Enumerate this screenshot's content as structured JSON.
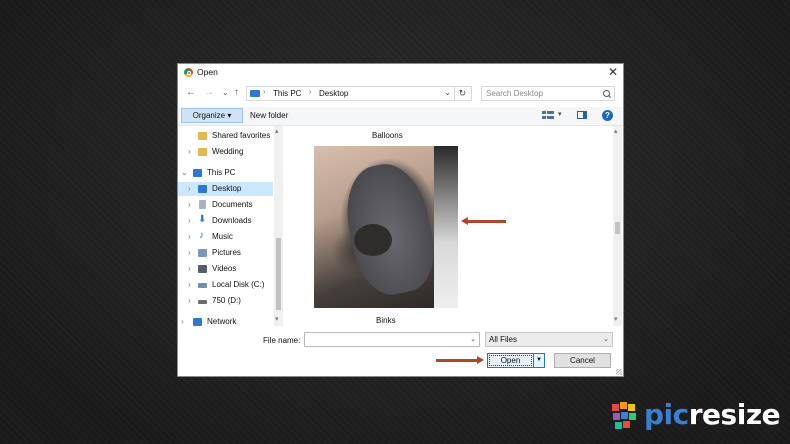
{
  "dialog": {
    "title": "Open",
    "app_icon": "chrome-icon",
    "close_glyph": "✕"
  },
  "navbar": {
    "back_glyph": "←",
    "forward_glyph": "→",
    "history_glyph": "⌄",
    "up_glyph": "↑",
    "breadcrumbs": [
      "This PC",
      "Desktop"
    ],
    "separator": "›",
    "refresh_glyph": "↻",
    "search_placeholder": "Search Desktop"
  },
  "toolbar": {
    "organize_label": "Organize ▾",
    "new_folder_label": "New folder",
    "help_glyph": "?"
  },
  "nav_pane": {
    "items": [
      {
        "label": "Shared favorites",
        "icon": "folder-image-icon",
        "color": "#e6b84a",
        "selected": false
      },
      {
        "label": "Wedding",
        "icon": "folder-image-icon",
        "color": "#e6b84a",
        "selected": false
      },
      {
        "label": "This PC",
        "icon": "computer-icon",
        "color": "#2b79d0",
        "selected": false
      },
      {
        "label": "Desktop",
        "icon": "desktop-icon",
        "color": "#2b79d0",
        "selected": true
      },
      {
        "label": "Documents",
        "icon": "documents-icon",
        "color": "#a9b3bf",
        "selected": false
      },
      {
        "label": "Downloads",
        "icon": "downloads-icon",
        "color": "#2b79d0",
        "selected": false
      },
      {
        "label": "Music",
        "icon": "music-icon",
        "color": "#2b79d0",
        "selected": false
      },
      {
        "label": "Pictures",
        "icon": "pictures-icon",
        "color": "#7a96b8",
        "selected": false
      },
      {
        "label": "Videos",
        "icon": "videos-icon",
        "color": "#545d69",
        "selected": false
      },
      {
        "label": "Local Disk (C:)",
        "icon": "drive-c-icon",
        "color": "#6f8fb5",
        "selected": false
      },
      {
        "label": "750 (D:)",
        "icon": "drive-icon",
        "color": "#6c6c6c",
        "selected": false
      },
      {
        "label": "Network",
        "icon": "network-icon",
        "color": "#2b79d0",
        "selected": false
      }
    ]
  },
  "content": {
    "items": [
      {
        "name": "Balloons"
      },
      {
        "name": "Binks"
      }
    ]
  },
  "footer": {
    "file_name_label": "File name:",
    "file_name_value": "",
    "file_type_value": "All Files",
    "open_label": "Open",
    "cancel_label": "Cancel"
  },
  "annotation": {
    "arrow_color": "#b0472a"
  },
  "logo": {
    "part1": "pic",
    "part2": "resize",
    "part1_color": "#3b7fd0",
    "part2_color": "#ffffff"
  }
}
